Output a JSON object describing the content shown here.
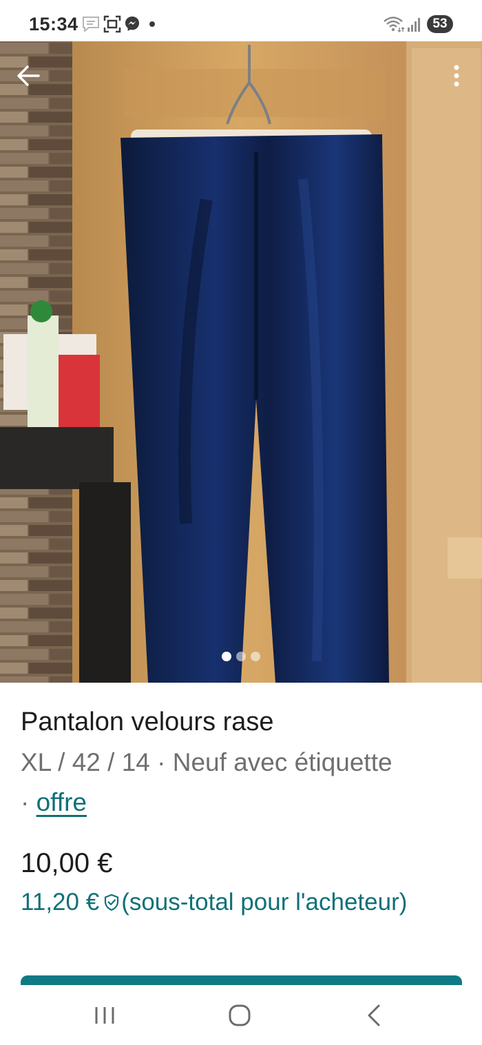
{
  "status_bar": {
    "time": "15:34",
    "battery": "53",
    "icons": [
      "chat-bubble-icon",
      "screenshot-icon",
      "messenger-icon",
      "dot-icon",
      "wifi-icon",
      "signal-icon"
    ]
  },
  "photo": {
    "image_count": 3,
    "active_index": 0,
    "back_icon": "arrow-left-icon",
    "menu_icon": "more-vertical-icon"
  },
  "listing": {
    "title": "Pantalon velours rase",
    "meta_prefix": "XL / 42 / 14 · Neuf avec étiquette",
    "meta_sep": "· ",
    "meta_link": "offre",
    "price": "10,00 €",
    "buyer_price": "11,20 €",
    "buyer_note": "(sous-total pour l'acheteur)"
  },
  "colors": {
    "accent": "#0f7077",
    "cta": "#0f7a83"
  },
  "navbar": {
    "icons": [
      "recent-apps-icon",
      "home-icon",
      "back-icon"
    ]
  }
}
